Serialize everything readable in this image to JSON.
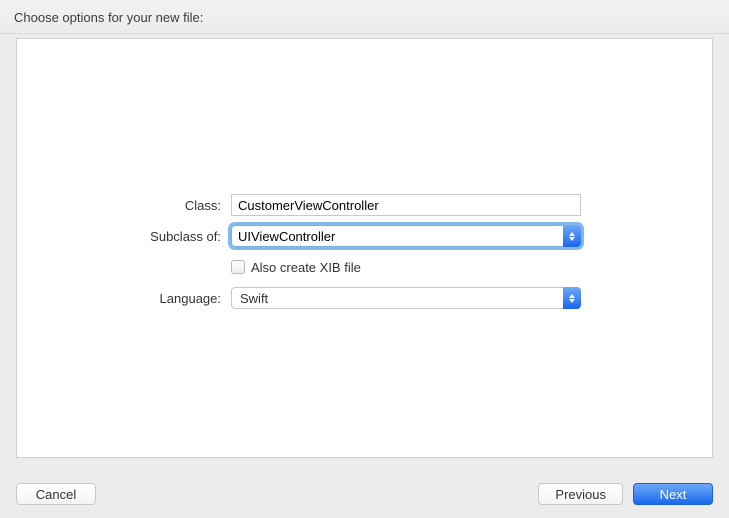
{
  "header": {
    "title": "Choose options for your new file:"
  },
  "form": {
    "class": {
      "label": "Class:",
      "value": "CustomerViewController"
    },
    "subclass": {
      "label": "Subclass of:",
      "value": "UIViewController"
    },
    "xib": {
      "label": "Also create XIB file",
      "checked": false
    },
    "language": {
      "label": "Language:",
      "value": "Swift"
    }
  },
  "footer": {
    "cancel": "Cancel",
    "previous": "Previous",
    "next": "Next"
  }
}
